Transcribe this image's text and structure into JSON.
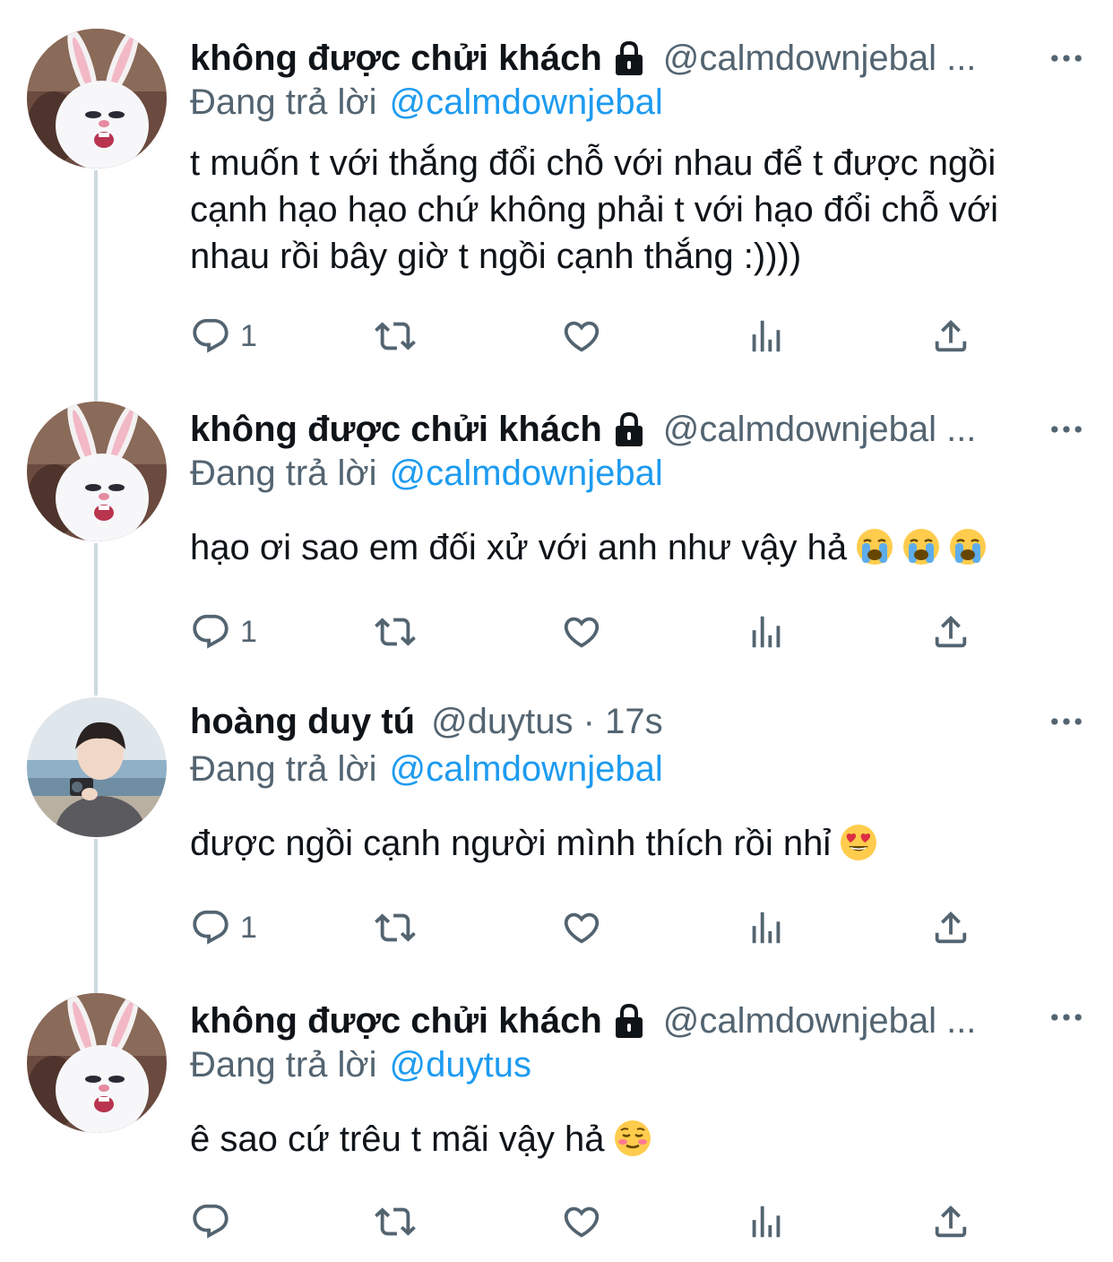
{
  "tweets": [
    {
      "avatar": "white-rabbit-avatar",
      "name": "không được chửi khách",
      "handle": "@calmdownjebal ...",
      "replying_label": "Đang trả lời",
      "replying_to": "@calmdownjebal",
      "text": "t muốn t với thắng đổi chỗ với nhau để t được ngồi cạnh hạo hạo chứ không phải t với hạo đổi chỗ với nhau rồi bây giờ t ngồi cạnh thắng :))))",
      "reply_count": "1"
    },
    {
      "avatar": "white-rabbit-avatar",
      "name": "không được chửi khách",
      "handle": "@calmdownjebal ...",
      "replying_label": "Đang trả lời",
      "replying_to": "@calmdownjebal",
      "text": "hạo ơi sao em đối xử với anh như vậy hả",
      "emojis": [
        "crying-face",
        "crying-face",
        "crying-face"
      ],
      "reply_count": "1"
    },
    {
      "avatar": "person-camera-avatar",
      "name": "hoàng duy tú",
      "handle": "@duytus · 17s",
      "replying_label": "Đang trả lời",
      "replying_to": "@calmdownjebal",
      "text": "được ngồi cạnh người mình thích rồi nhỉ",
      "emojis": [
        "heart-eyes-face"
      ],
      "reply_count": "1"
    },
    {
      "avatar": "white-rabbit-avatar",
      "name": "không được chửi khách",
      "handle": "@calmdownjebal ...",
      "replying_label": "Đang trả lời",
      "replying_to": "@duytus",
      "text": "ê sao cứ trêu t mãi vậy hả",
      "emojis": [
        "smiling-blush-face"
      ],
      "reply_count": ""
    }
  ],
  "colors": {
    "text": "#0f1419",
    "secondary": "#536471",
    "link": "#1d9bf0",
    "thread_line": "#cfd9de"
  }
}
